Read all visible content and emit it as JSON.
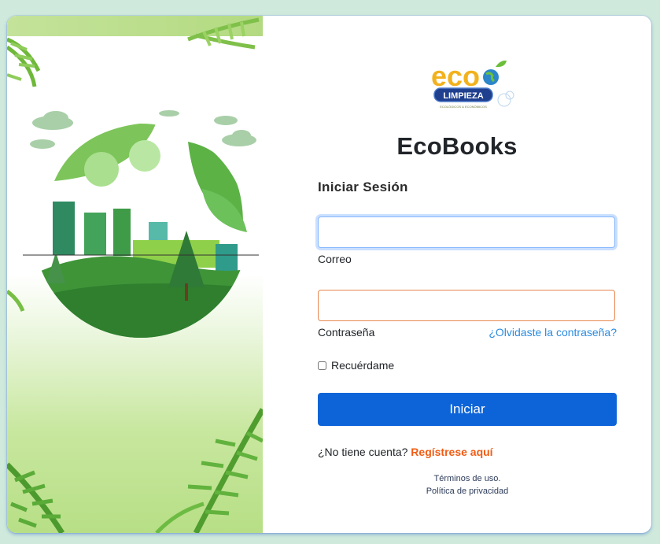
{
  "brand": {
    "title": "EcoBooks",
    "logo_word": "eco",
    "logo_badge": "LIMPIEZA",
    "logo_tagline": "ECOLÓGICOS & ECONÓMICOS"
  },
  "login": {
    "section_title": "Iniciar Sesión",
    "email_label": "Correo",
    "email_value": "",
    "password_label": "Contraseña",
    "password_value": "",
    "forgot_link": "¿Olvidaste la contraseña?",
    "remember_label": "Recuérdame",
    "remember_checked": false,
    "submit_label": "Iniciar"
  },
  "register": {
    "prompt": "¿No tiene cuenta?",
    "link": "Regístrese aquí"
  },
  "footer": {
    "terms": "Términos de uso.",
    "privacy": "Política de privacidad"
  },
  "colors": {
    "page_bg": "#cfe9dc",
    "primary_button": "#0d64d8",
    "register_link": "#f25c14",
    "forgot_link": "#2b8be0",
    "email_focus_border": "#86b7fe",
    "password_border": "#e8874e"
  },
  "icons": [
    "palm-leaf-icon",
    "globe-icon",
    "leaf-icon",
    "cloud-icon",
    "tree-icon",
    "building-icon"
  ]
}
